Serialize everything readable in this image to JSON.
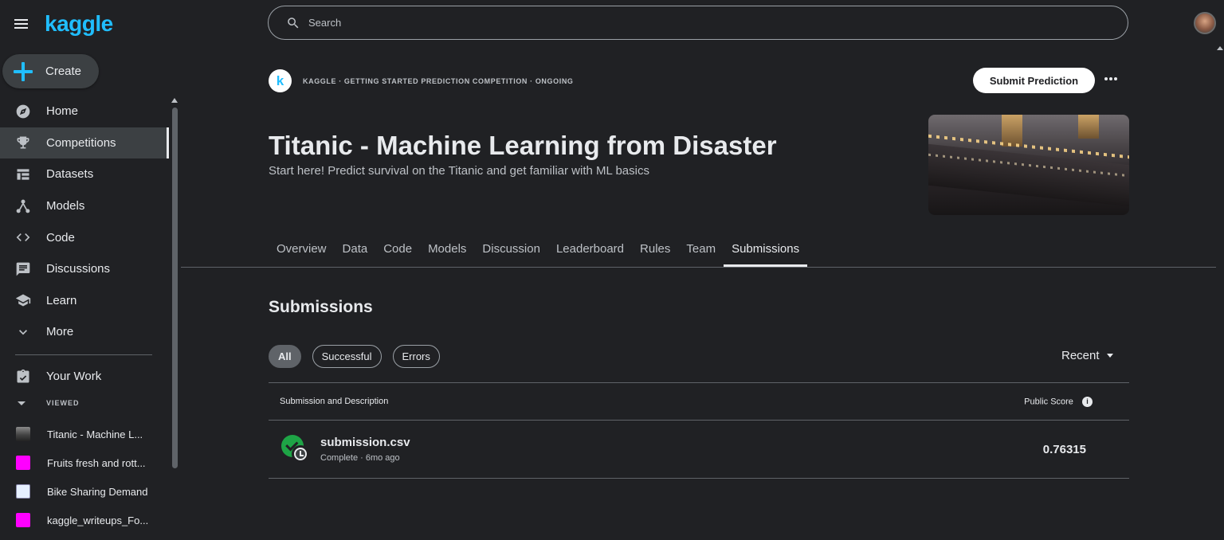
{
  "brand": {
    "logo": "kaggle"
  },
  "sidebar": {
    "create_label": "Create",
    "items": [
      {
        "label": "Home",
        "icon": "compass-icon"
      },
      {
        "label": "Competitions",
        "icon": "trophy-icon",
        "active": true
      },
      {
        "label": "Datasets",
        "icon": "table-icon"
      },
      {
        "label": "Models",
        "icon": "models-icon"
      },
      {
        "label": "Code",
        "icon": "code-icon"
      },
      {
        "label": "Discussions",
        "icon": "comment-icon"
      },
      {
        "label": "Learn",
        "icon": "school-icon"
      },
      {
        "label": "More",
        "icon": "chevron-down-icon"
      }
    ],
    "your_work": "Your Work",
    "viewed_label": "VIEWED",
    "recent": [
      {
        "label": "Titanic - Machine L..."
      },
      {
        "label": "Fruits fresh and rott..."
      },
      {
        "label": "Bike Sharing Demand"
      },
      {
        "label": "kaggle_writeups_Fo..."
      }
    ]
  },
  "search": {
    "placeholder": "Search"
  },
  "competition": {
    "badge": "k",
    "meta": "KAGGLE · GETTING STARTED PREDICTION COMPETITION · ONGOING",
    "submit_label": "Submit Prediction",
    "title": "Titanic - Machine Learning from Disaster",
    "subtitle": "Start here! Predict survival on the Titanic and get familiar with ML basics"
  },
  "tabs": [
    "Overview",
    "Data",
    "Code",
    "Models",
    "Discussion",
    "Leaderboard",
    "Rules",
    "Team",
    "Submissions"
  ],
  "active_tab": "Submissions",
  "submissions": {
    "title": "Submissions",
    "filters": [
      "All",
      "Successful",
      "Errors"
    ],
    "sort_label": "Recent",
    "columns": {
      "description": "Submission and Description",
      "score": "Public Score",
      "info": "i"
    },
    "rows": [
      {
        "file": "submission.csv",
        "meta": "Complete · 6mo ago",
        "score": "0.76315"
      }
    ]
  },
  "colors": {
    "accent": "#20beff",
    "background": "#202124",
    "success": "#1ea446"
  }
}
